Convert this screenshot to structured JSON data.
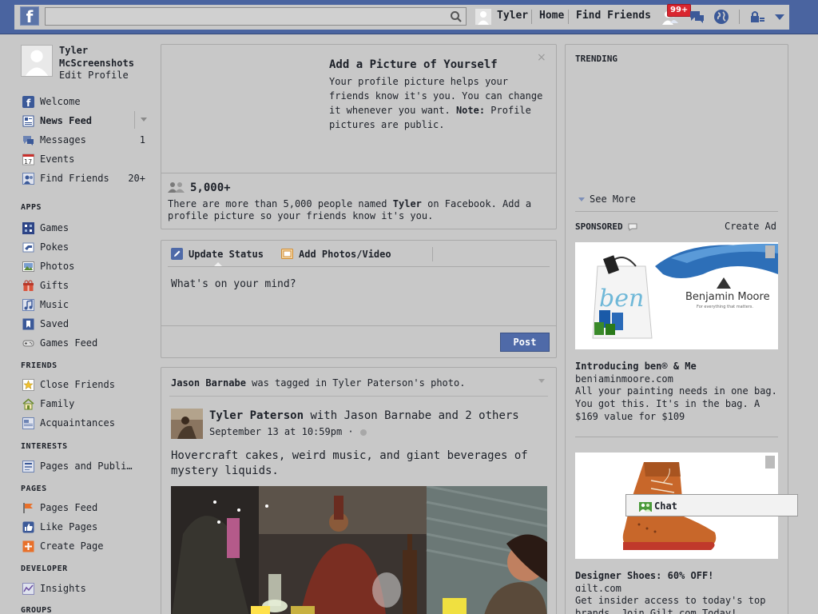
{
  "topbar": {
    "logo": "f",
    "search": {
      "value": "",
      "placeholder": ""
    },
    "user_name": "Tyler",
    "home": "Home",
    "find_friends": "Find Friends",
    "notif_badge": "99+"
  },
  "profile": {
    "name": "Tyler McScreenshots",
    "edit": "Edit Profile"
  },
  "nav": {
    "main": [
      {
        "label": "Welcome",
        "count": ""
      },
      {
        "label": "News Feed",
        "count": ""
      },
      {
        "label": "Messages",
        "count": "1"
      },
      {
        "label": "Events",
        "count": ""
      },
      {
        "label": "Find Friends",
        "count": "20+"
      }
    ],
    "apps_head": "APPS",
    "apps": [
      "Games",
      "Pokes",
      "Photos",
      "Gifts",
      "Music",
      "Saved",
      "Games Feed"
    ],
    "friends_head": "FRIENDS",
    "friends": [
      "Close Friends",
      "Family",
      "Acquaintances"
    ],
    "interests_head": "INTERESTS",
    "interests": [
      "Pages and Publi…"
    ],
    "pages_head": "PAGES",
    "pages": [
      "Pages Feed",
      "Like Pages",
      "Create Page"
    ],
    "developer_head": "DEVELOPER",
    "developer": [
      "Insights"
    ],
    "groups_head": "GROUPS",
    "events_icon_day": "17"
  },
  "pic_card": {
    "title": "Add a Picture of Yourself",
    "text_pre": "Your profile picture helps your friends know it's you. You can change it whenever you want. ",
    "text_note": "Note:",
    "text_post": " Profile pictures are public.",
    "close": "×",
    "count": "5,000+",
    "people_pre": "There are more than 5,000 people named ",
    "people_name": "Tyler",
    "people_post": " on Facebook. Add a profile picture so your friends know it's you."
  },
  "composer": {
    "tab_status": "Update Status",
    "tab_photos": "Add Photos/Video",
    "placeholder": "What's on your mind?",
    "post": "Post"
  },
  "story": {
    "tagged_name": "Jason Barnabe",
    "tagged_text": " was tagged in Tyler Paterson's photo.",
    "author": "Tyler Paterson",
    "with_text": " with Jason Barnabe and 2 others",
    "time": "September 13 at 10:59pm · ",
    "body": "Hovercraft cakes, weird music, and giant beverages of mystery liquids."
  },
  "right": {
    "trending": "TRENDING",
    "see_more": "See More",
    "sponsored": "SPONSORED",
    "create_ad": "Create Ad",
    "ads": [
      {
        "brand_text": "Benjamin Moore",
        "brand_tag": "For everything that matters.",
        "title": "Introducing ben® & Me",
        "domain": "benjaminmoore.com",
        "body": "All your painting needs in one bag. You got this. It's in the bag. A $169 value for $109"
      },
      {
        "title": "Designer Shoes: 60% OFF!",
        "domain": "gilt.com",
        "body": "Get insider access to today's top brands. Join Gilt.com Today!"
      }
    ]
  },
  "chat": {
    "label": "Chat"
  },
  "colors": {
    "brand": "#4a64a0",
    "badge": "#d9262f",
    "post_button": "#4f6aa8"
  }
}
